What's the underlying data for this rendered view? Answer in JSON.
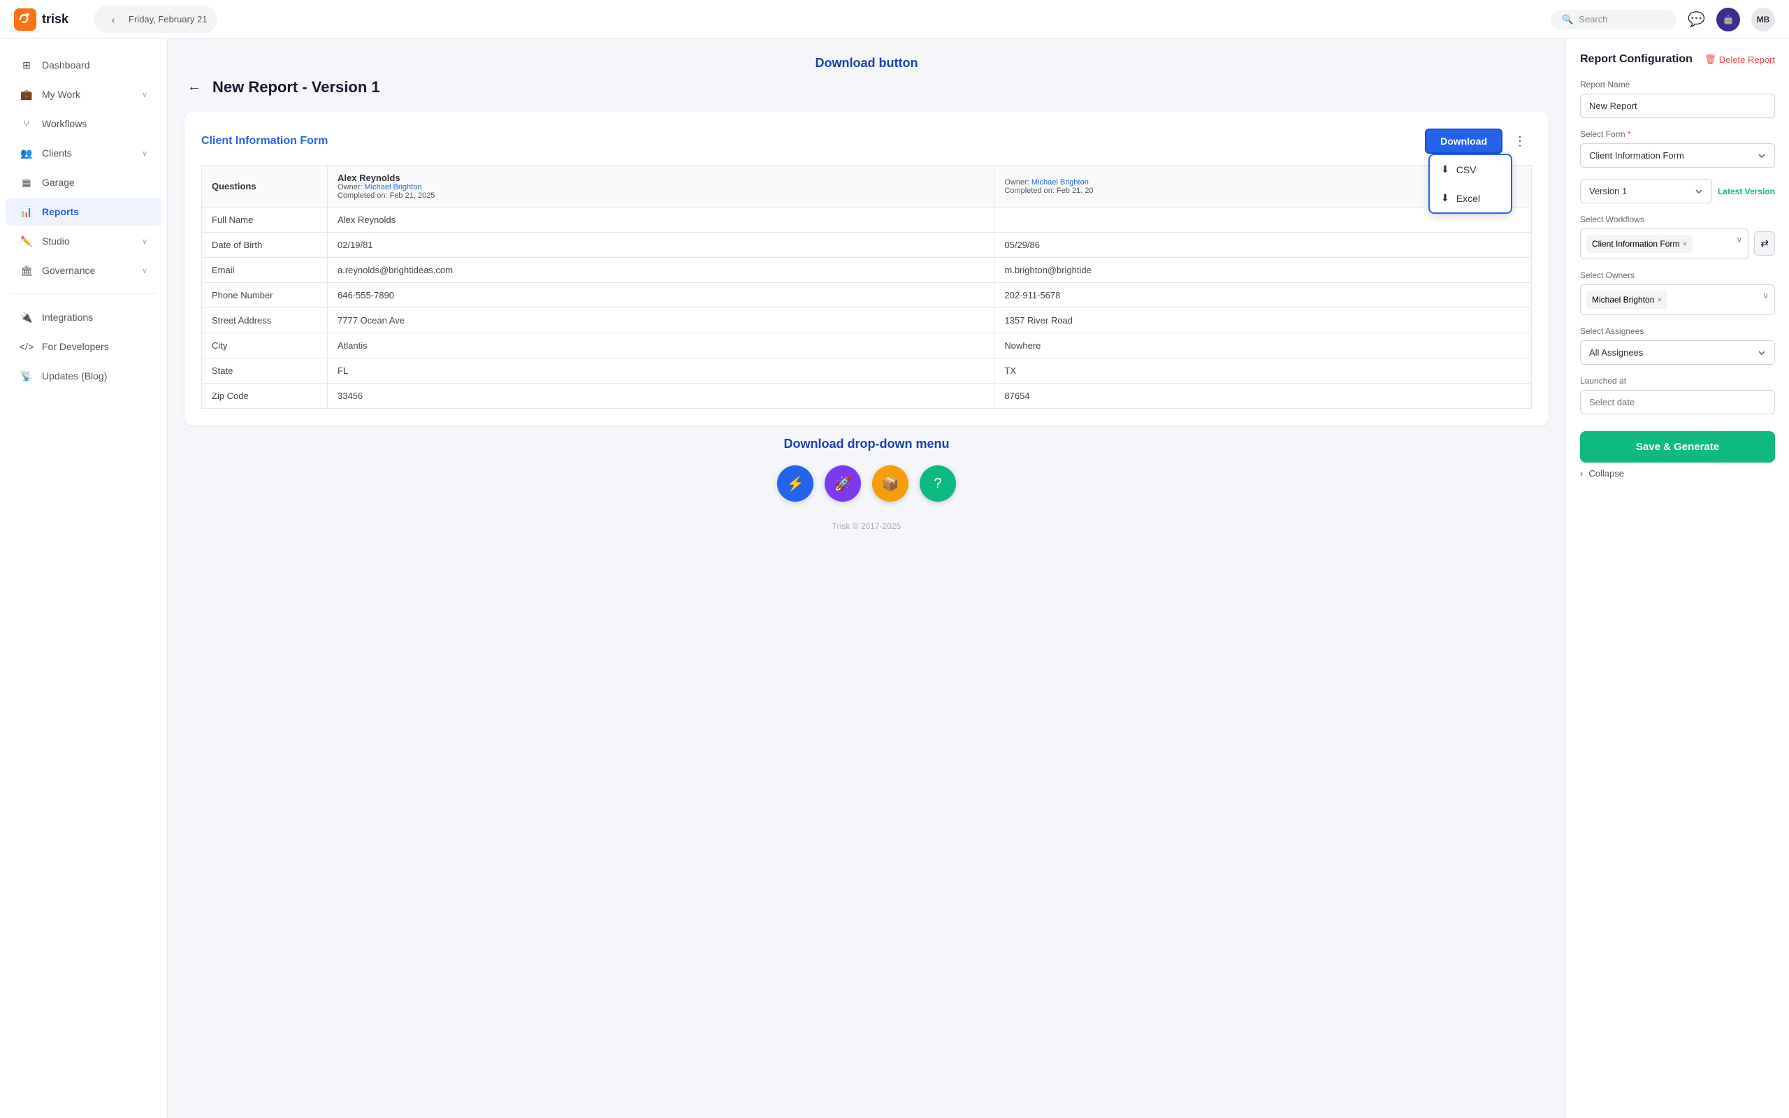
{
  "app": {
    "name": "trisk",
    "logo_text": "trisk"
  },
  "topnav": {
    "date": "Friday, February 21",
    "search_placeholder": "Search",
    "user_initials": "MB",
    "back_btn_label": "‹"
  },
  "sidebar": {
    "items": [
      {
        "id": "dashboard",
        "label": "Dashboard",
        "icon": "grid",
        "active": false
      },
      {
        "id": "my-work",
        "label": "My Work",
        "icon": "briefcase",
        "active": false,
        "chevron": true
      },
      {
        "id": "workflows",
        "label": "Workflows",
        "icon": "git-branch",
        "active": false
      },
      {
        "id": "clients",
        "label": "Clients",
        "icon": "users",
        "active": false,
        "chevron": true
      },
      {
        "id": "garage",
        "label": "Garage",
        "icon": "layout",
        "active": false
      },
      {
        "id": "reports",
        "label": "Reports",
        "icon": "bar-chart",
        "active": true
      },
      {
        "id": "studio",
        "label": "Studio",
        "icon": "edit",
        "active": false,
        "chevron": true
      },
      {
        "id": "governance",
        "label": "Governance",
        "icon": "shield",
        "active": false,
        "chevron": true
      },
      {
        "id": "integrations",
        "label": "Integrations",
        "icon": "plug",
        "active": false
      },
      {
        "id": "for-developers",
        "label": "For Developers",
        "icon": "code",
        "active": false
      },
      {
        "id": "updates-blog",
        "label": "Updates (Blog)",
        "icon": "rss",
        "active": false
      }
    ]
  },
  "report_view": {
    "back_label": "←",
    "title": "New Report - Version 1",
    "card": {
      "form_title": "Client Information Form",
      "download_btn_label": "Download",
      "dropdown_items": [
        "CSV",
        "Excel"
      ],
      "table": {
        "columns": [
          {
            "key": "question",
            "label": "Questions"
          },
          {
            "key": "alex",
            "owner_name": "Alex Reynolds",
            "owner_label": "Owner:",
            "owner_link": "Michael Brighton",
            "completed_label": "Completed on:",
            "completed_date": "Feb 21, 2025"
          },
          {
            "key": "michael",
            "owner_name": "",
            "owner_label": "Owner:",
            "owner_link": "Michael Brighton",
            "completed_label": "Completed on:",
            "completed_date": "Feb 21, 20"
          }
        ],
        "rows": [
          {
            "question": "Full Name",
            "alex": "Alex Reynolds",
            "michael": ""
          },
          {
            "question": "Date of Birth",
            "alex": "02/19/81",
            "michael": "05/29/86"
          },
          {
            "question": "Email",
            "alex": "a.reynolds@brightideas.com",
            "michael": "m.brighton@brightide"
          },
          {
            "question": "Phone Number",
            "alex": "646-555-7890",
            "michael": "202-911-5678"
          },
          {
            "question": "Street Address",
            "alex": "7777 Ocean Ave",
            "michael": "1357 River Road"
          },
          {
            "question": "City",
            "alex": "Atlantis",
            "michael": "Nowhere"
          },
          {
            "question": "State",
            "alex": "FL",
            "michael": "TX"
          },
          {
            "question": "Zip Code",
            "alex": "33456",
            "michael": "87654"
          }
        ]
      }
    },
    "fabs": [
      {
        "id": "lightning",
        "color": "blue",
        "icon": "⚡"
      },
      {
        "id": "rocket",
        "color": "purple",
        "icon": "🚀"
      },
      {
        "id": "archive",
        "color": "orange",
        "icon": "📦"
      },
      {
        "id": "help",
        "color": "green",
        "icon": "?"
      }
    ],
    "footer": "Trisk © 2017-2025"
  },
  "right_panel": {
    "title": "Report Configuration",
    "delete_label": "Delete Report",
    "fields": {
      "report_name_label": "Report Name",
      "report_name_value": "New Report",
      "report_name_placeholder": "New Report",
      "select_form_label": "Select Form",
      "select_form_required": true,
      "select_form_value": "Client Information Form",
      "version_label": "",
      "version_value": "Version 1",
      "version_latest": "Latest Version",
      "select_workflows_label": "Select Workflows",
      "workflow_tag": "Client Information Form",
      "select_owners_label": "Select Owners",
      "owner_tag": "Michael Brighton",
      "select_assignees_label": "Select Assignees",
      "assignees_value": "All Assignees",
      "launched_at_label": "Launched at",
      "launched_at_placeholder": "Select date"
    },
    "save_btn_label": "Save & Generate",
    "collapse_label": "Collapse"
  },
  "annotations": {
    "download_button_label": "Download button",
    "dropdown_menu_label": "Download drop-down menu"
  }
}
